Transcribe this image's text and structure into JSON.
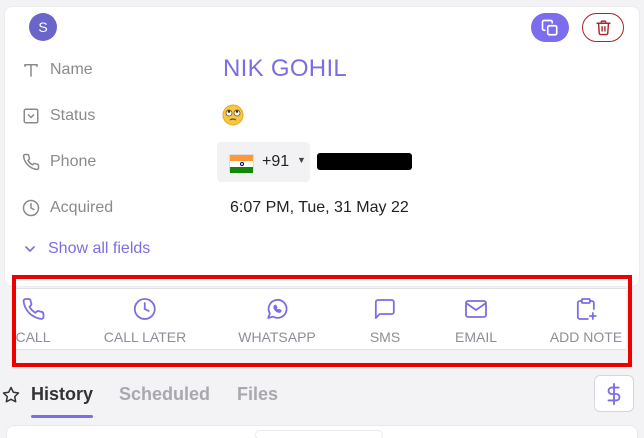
{
  "contact": {
    "avatar_letter": "S",
    "name": "NIK GOHIL",
    "status_icon": "face-with-rolling-eyes-emoji",
    "phone": {
      "country_flag": "india-flag",
      "dial_code": "+91"
    },
    "acquired": "6:07 PM, Tue, 31 May 22"
  },
  "fields": {
    "name_label": "Name",
    "status_label": "Status",
    "phone_label": "Phone",
    "acquired_label": "Acquired"
  },
  "show_all_fields": "Show all fields",
  "actions": [
    {
      "label": "CALL",
      "icon": "phone-icon"
    },
    {
      "label": "CALL LATER",
      "icon": "clock-icon"
    },
    {
      "label": "WHATSAPP",
      "icon": "whatsapp-icon"
    },
    {
      "label": "SMS",
      "icon": "message-icon"
    },
    {
      "label": "EMAIL",
      "icon": "mail-icon"
    },
    {
      "label": "ADD NOTE",
      "icon": "clipboard-plus-icon"
    }
  ],
  "tabs": [
    {
      "label": "History",
      "active": true
    },
    {
      "label": "Scheduled",
      "active": false
    },
    {
      "label": "Files",
      "active": false
    }
  ],
  "colors": {
    "accent": "#7a6ee5",
    "highlight": "#e00000",
    "delete": "#a8262b",
    "avatar": "#6a65c8"
  }
}
